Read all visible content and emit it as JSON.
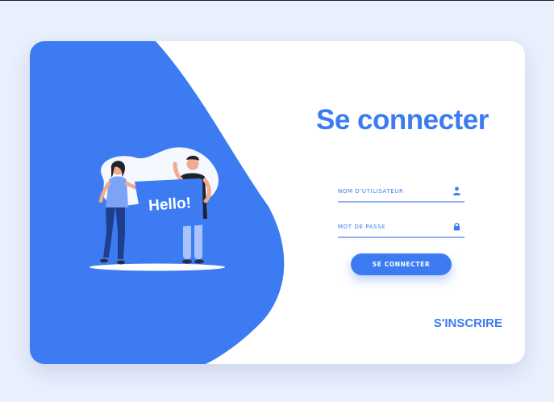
{
  "login": {
    "title": "Se connecter",
    "username_placeholder": "NOM D'UTILISATEUR",
    "password_placeholder": "MOT DE PASSE",
    "submit_label": "SE CONNECTER",
    "signup_label": "S'INSCRIRE"
  },
  "illustration": {
    "speech_text": "Hello!"
  },
  "icons": {
    "username": "user-icon",
    "password": "lock-icon"
  },
  "colors": {
    "accent": "#3d7bf3",
    "background": "#eaf0fd",
    "card": "#ffffff",
    "field_line": "#8fb2f8"
  }
}
